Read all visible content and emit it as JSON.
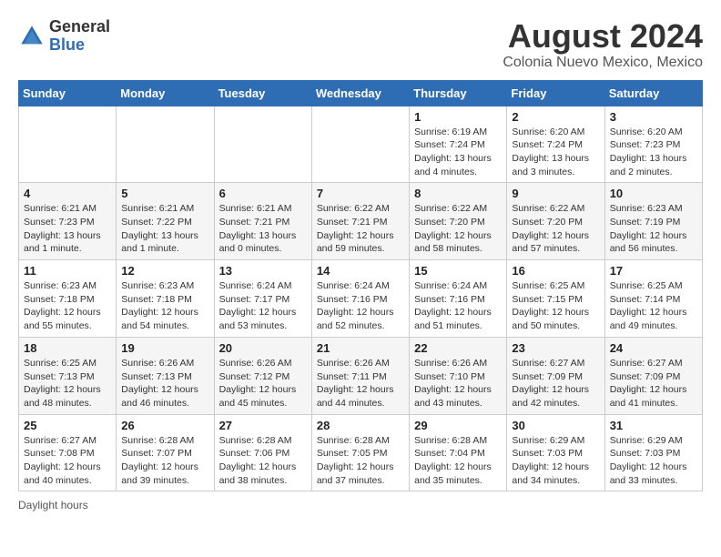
{
  "header": {
    "logo_general": "General",
    "logo_blue": "Blue",
    "month_year": "August 2024",
    "location": "Colonia Nuevo Mexico, Mexico"
  },
  "footer": {
    "label": "Daylight hours"
  },
  "days_of_week": [
    "Sunday",
    "Monday",
    "Tuesday",
    "Wednesday",
    "Thursday",
    "Friday",
    "Saturday"
  ],
  "weeks": [
    [
      {
        "day": "",
        "info": ""
      },
      {
        "day": "",
        "info": ""
      },
      {
        "day": "",
        "info": ""
      },
      {
        "day": "",
        "info": ""
      },
      {
        "day": "1",
        "info": "Sunrise: 6:19 AM\nSunset: 7:24 PM\nDaylight: 13 hours and 4 minutes."
      },
      {
        "day": "2",
        "info": "Sunrise: 6:20 AM\nSunset: 7:24 PM\nDaylight: 13 hours and 3 minutes."
      },
      {
        "day": "3",
        "info": "Sunrise: 6:20 AM\nSunset: 7:23 PM\nDaylight: 13 hours and 2 minutes."
      }
    ],
    [
      {
        "day": "4",
        "info": "Sunrise: 6:21 AM\nSunset: 7:23 PM\nDaylight: 13 hours and 1 minute."
      },
      {
        "day": "5",
        "info": "Sunrise: 6:21 AM\nSunset: 7:22 PM\nDaylight: 13 hours and 1 minute."
      },
      {
        "day": "6",
        "info": "Sunrise: 6:21 AM\nSunset: 7:21 PM\nDaylight: 13 hours and 0 minutes."
      },
      {
        "day": "7",
        "info": "Sunrise: 6:22 AM\nSunset: 7:21 PM\nDaylight: 12 hours and 59 minutes."
      },
      {
        "day": "8",
        "info": "Sunrise: 6:22 AM\nSunset: 7:20 PM\nDaylight: 12 hours and 58 minutes."
      },
      {
        "day": "9",
        "info": "Sunrise: 6:22 AM\nSunset: 7:20 PM\nDaylight: 12 hours and 57 minutes."
      },
      {
        "day": "10",
        "info": "Sunrise: 6:23 AM\nSunset: 7:19 PM\nDaylight: 12 hours and 56 minutes."
      }
    ],
    [
      {
        "day": "11",
        "info": "Sunrise: 6:23 AM\nSunset: 7:18 PM\nDaylight: 12 hours and 55 minutes."
      },
      {
        "day": "12",
        "info": "Sunrise: 6:23 AM\nSunset: 7:18 PM\nDaylight: 12 hours and 54 minutes."
      },
      {
        "day": "13",
        "info": "Sunrise: 6:24 AM\nSunset: 7:17 PM\nDaylight: 12 hours and 53 minutes."
      },
      {
        "day": "14",
        "info": "Sunrise: 6:24 AM\nSunset: 7:16 PM\nDaylight: 12 hours and 52 minutes."
      },
      {
        "day": "15",
        "info": "Sunrise: 6:24 AM\nSunset: 7:16 PM\nDaylight: 12 hours and 51 minutes."
      },
      {
        "day": "16",
        "info": "Sunrise: 6:25 AM\nSunset: 7:15 PM\nDaylight: 12 hours and 50 minutes."
      },
      {
        "day": "17",
        "info": "Sunrise: 6:25 AM\nSunset: 7:14 PM\nDaylight: 12 hours and 49 minutes."
      }
    ],
    [
      {
        "day": "18",
        "info": "Sunrise: 6:25 AM\nSunset: 7:13 PM\nDaylight: 12 hours and 48 minutes."
      },
      {
        "day": "19",
        "info": "Sunrise: 6:26 AM\nSunset: 7:13 PM\nDaylight: 12 hours and 46 minutes."
      },
      {
        "day": "20",
        "info": "Sunrise: 6:26 AM\nSunset: 7:12 PM\nDaylight: 12 hours and 45 minutes."
      },
      {
        "day": "21",
        "info": "Sunrise: 6:26 AM\nSunset: 7:11 PM\nDaylight: 12 hours and 44 minutes."
      },
      {
        "day": "22",
        "info": "Sunrise: 6:26 AM\nSunset: 7:10 PM\nDaylight: 12 hours and 43 minutes."
      },
      {
        "day": "23",
        "info": "Sunrise: 6:27 AM\nSunset: 7:09 PM\nDaylight: 12 hours and 42 minutes."
      },
      {
        "day": "24",
        "info": "Sunrise: 6:27 AM\nSunset: 7:09 PM\nDaylight: 12 hours and 41 minutes."
      }
    ],
    [
      {
        "day": "25",
        "info": "Sunrise: 6:27 AM\nSunset: 7:08 PM\nDaylight: 12 hours and 40 minutes."
      },
      {
        "day": "26",
        "info": "Sunrise: 6:28 AM\nSunset: 7:07 PM\nDaylight: 12 hours and 39 minutes."
      },
      {
        "day": "27",
        "info": "Sunrise: 6:28 AM\nSunset: 7:06 PM\nDaylight: 12 hours and 38 minutes."
      },
      {
        "day": "28",
        "info": "Sunrise: 6:28 AM\nSunset: 7:05 PM\nDaylight: 12 hours and 37 minutes."
      },
      {
        "day": "29",
        "info": "Sunrise: 6:28 AM\nSunset: 7:04 PM\nDaylight: 12 hours and 35 minutes."
      },
      {
        "day": "30",
        "info": "Sunrise: 6:29 AM\nSunset: 7:03 PM\nDaylight: 12 hours and 34 minutes."
      },
      {
        "day": "31",
        "info": "Sunrise: 6:29 AM\nSunset: 7:03 PM\nDaylight: 12 hours and 33 minutes."
      }
    ]
  ]
}
